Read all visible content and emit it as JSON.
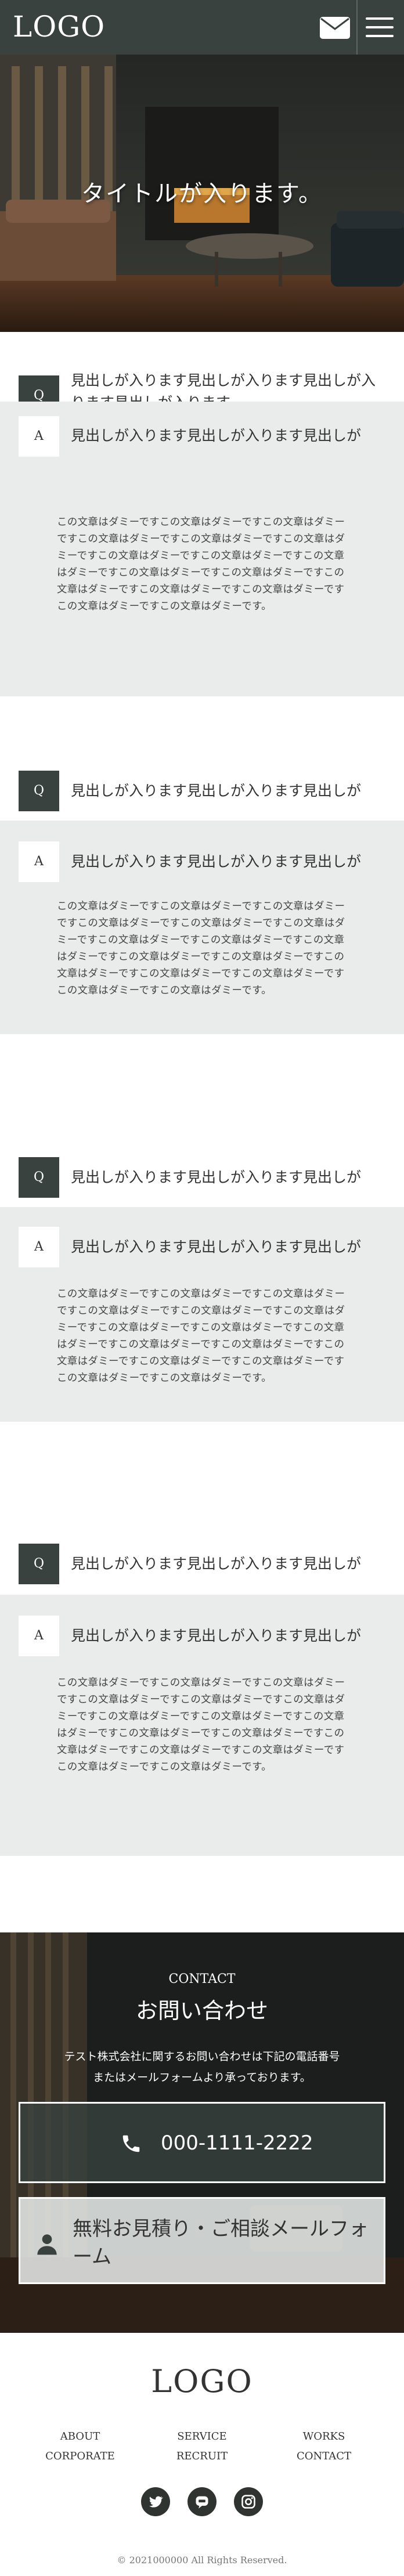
{
  "header": {
    "logo": "LOGO"
  },
  "hero": {
    "title": "タイトルが入ります。"
  },
  "faq": [
    {
      "q": "見出しが入ります見出しが入ります見出しが入ります見出しが入ります",
      "a_head": "見出しが入ります見出しが入ります見出しが",
      "a_body": "この文章はダミーですこの文章はダミーですこの文章はダミーですこの文章はダミーですこの文章はダミーですこの文章はダミーですこの文章はダミーですこの文章はダミーですこの文章はダミーですこの文章はダミーですこの文章はダミーですこの文章はダミーですこの文章はダミーですこの文章はダミーですこの文章はダミーですこの文章はダミーです。"
    },
    {
      "q": "見出しが入ります見出しが入ります見出しが",
      "a_head": "見出しが入ります見出しが入ります見出しが",
      "a_body": "この文章はダミーですこの文章はダミーですこの文章はダミーですこの文章はダミーですこの文章はダミーですこの文章はダミーですこの文章はダミーですこの文章はダミーですこの文章はダミーですこの文章はダミーですこの文章はダミーですこの文章はダミーですこの文章はダミーですこの文章はダミーですこの文章はダミーですこの文章はダミーです。"
    },
    {
      "q": "見出しが入ります見出しが入ります見出しが",
      "a_head": "見出しが入ります見出しが入ります見出しが",
      "a_body": "この文章はダミーですこの文章はダミーですこの文章はダミーですこの文章はダミーですこの文章はダミーですこの文章はダミーですこの文章はダミーですこの文章はダミーですこの文章はダミーですこの文章はダミーですこの文章はダミーですこの文章はダミーですこの文章はダミーですこの文章はダミーですこの文章はダミーですこの文章はダミーです。"
    },
    {
      "q": "見出しが入ります見出しが入ります見出しが",
      "a_head": "見出しが入ります見出しが入ります見出しが",
      "a_body": "この文章はダミーですこの文章はダミーですこの文章はダミーですこの文章はダミーですこの文章はダミーですこの文章はダミーですこの文章はダミーですこの文章はダミーですこの文章はダミーですこの文章はダミーですこの文章はダミーですこの文章はダミーですこの文章はダミーですこの文章はダミーですこの文章はダミーですこの文章はダミーです。"
    }
  ],
  "labels": {
    "q": "Q",
    "a": "A"
  },
  "contact": {
    "subtitle": "CONTACT",
    "title": "お問い合わせ",
    "lead_1": "テスト株式会社に関するお問い合わせは下記の電話番号",
    "lead_2": "またはメールフォームより承っております。",
    "tel": "000-1111-2222",
    "mail_label": "無料お見積り・ご相談メールフォーム"
  },
  "footer": {
    "logo": "LOGO",
    "nav": [
      "ABOUT",
      "SERVICE",
      "WORKS",
      "CORPORATE",
      "RECRUIT",
      "CONTACT"
    ],
    "sns": [
      "twitter-icon",
      "line-icon",
      "instagram-icon"
    ],
    "copyright": "© 2021000000 All Rights Reserved."
  },
  "colors": {
    "primary": "#39423f",
    "light": "#e9ecea",
    "white": "#ffffff"
  }
}
